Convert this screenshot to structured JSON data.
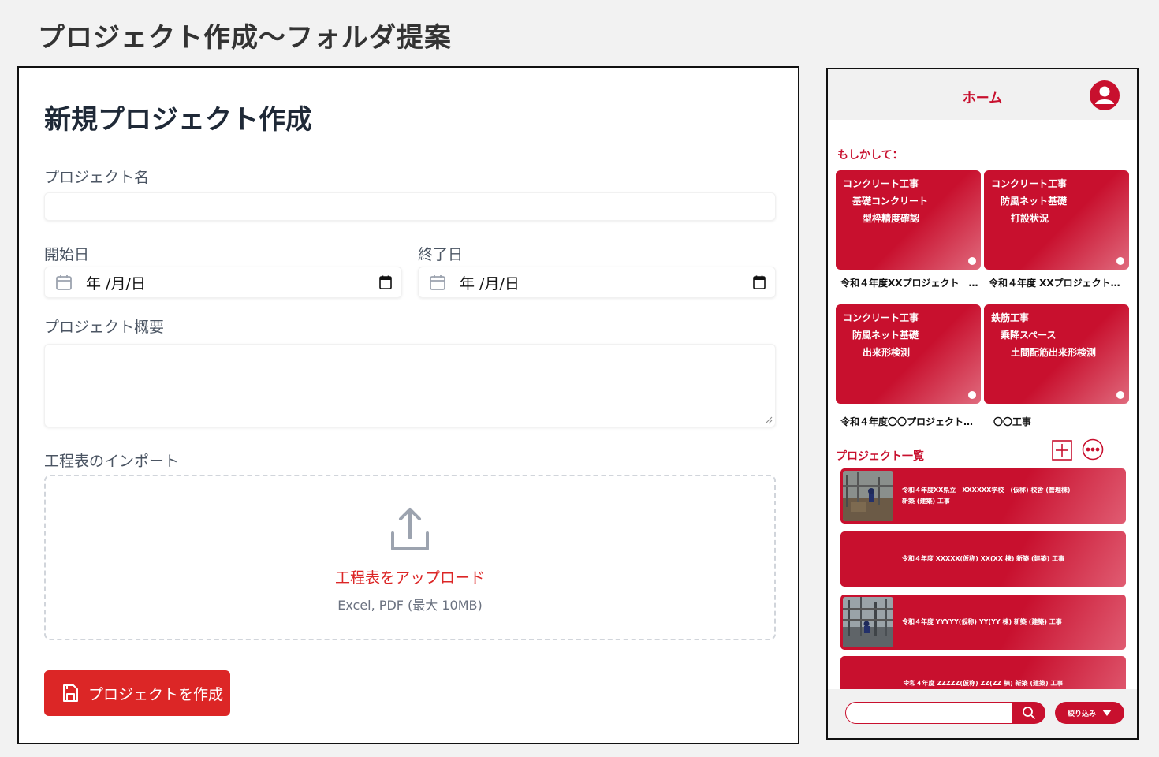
{
  "page_title": "プロジェクト作成〜フォルダ提案",
  "form": {
    "title": "新規プロジェクト作成",
    "project_name_label": "プロジェクト名",
    "project_name_value": "",
    "start_date_label": "開始日",
    "start_date_value": "年 /月/日",
    "end_date_label": "終了日",
    "end_date_value": "年 /月/日",
    "summary_label": "プロジェクト概要",
    "summary_value": "",
    "schedule_import_label": "工程表のインポート",
    "upload_title": "工程表をアップロード",
    "upload_hint": "Excel, PDF (最大 10MB)",
    "create_button": "プロジェクトを作成",
    "accent_color": "#dc2626"
  },
  "phone": {
    "header_title": "ホーム",
    "suggest_label": "もしかして：",
    "suggestions": [
      {
        "line1": "コンクリート工事",
        "line2": "基礎コンクリート",
        "line3": "型枠精度確認",
        "caption": "令和４年度XXプロジェクト　…"
      },
      {
        "line1": "コンクリート工事",
        "line2": "防風ネット基礎",
        "line3": "打設状況",
        "caption": "令和４年度 XXプロジェクト…"
      },
      {
        "line1": "コンクリート工事",
        "line2": "防風ネット基礎",
        "line3": "出来形検測",
        "caption": "令和４年度〇〇プロジェクト…"
      },
      {
        "line1": "鉄筋工事",
        "line2": "乗降スペース",
        "line3": "土間配筋出来形検測",
        "caption": "〇〇工事"
      }
    ],
    "project_list_label": "プロジェクト一覧",
    "projects": [
      {
        "line1": "令和４年度XX県立　XXXXXX学校　(仮称) 校舎 (管理棟)",
        "line2": "新築 (建築) 工事",
        "has_photo": true
      },
      {
        "line1": "令和４年度 XXXXX(仮称) XX(XX 棟) 新築 (建築) 工事",
        "line2": "",
        "has_photo": false
      },
      {
        "line1": "令和４年度 YYYYY(仮称) YY(YY 棟) 新築 (建築) 工事",
        "line2": "",
        "has_photo": true
      },
      {
        "line1": "令和４年度 ZZZZZ(仮称) ZZ(ZZ 棟) 新築 (建築) 工事",
        "line2": "",
        "has_photo": false
      }
    ],
    "search_placeholder": "",
    "filter_button": "絞り込み",
    "brand_color": "#c8102e"
  }
}
